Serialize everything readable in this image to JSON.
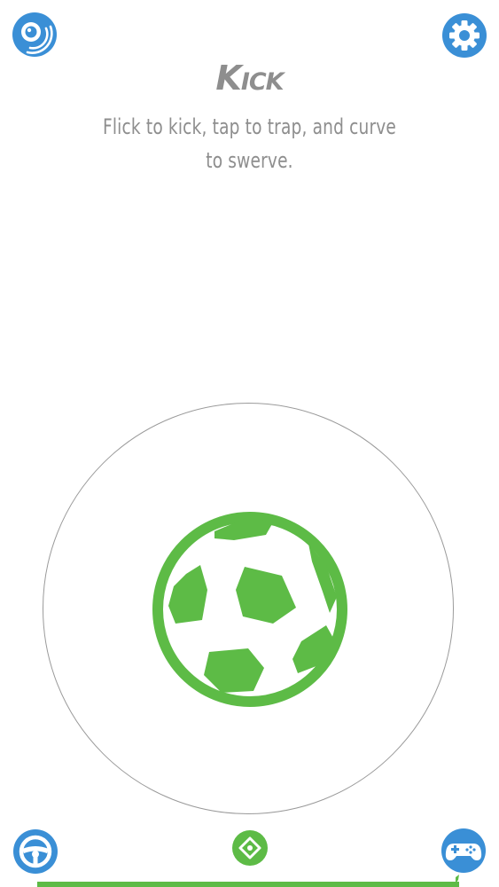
{
  "mode": {
    "title": "Kick",
    "instructions_line1": "Flick to kick, tap to trap, and curve",
    "instructions_line2": "to swerve."
  },
  "buttons": {
    "top_left_icon": "sphero-connection-icon",
    "top_right_icon": "gear-icon",
    "bottom_left_icon": "steering-wheel-icon",
    "bottom_center_icon": "aim-icon",
    "bottom_right_icon": "gamepad-icon"
  },
  "colors": {
    "accent_blue": "#3a8fd6",
    "accent_green": "#5dbb46",
    "text_gray": "#8e8e8e",
    "ring_gray": "#9a9a9a"
  },
  "progress": {
    "fraction": 1.0
  }
}
